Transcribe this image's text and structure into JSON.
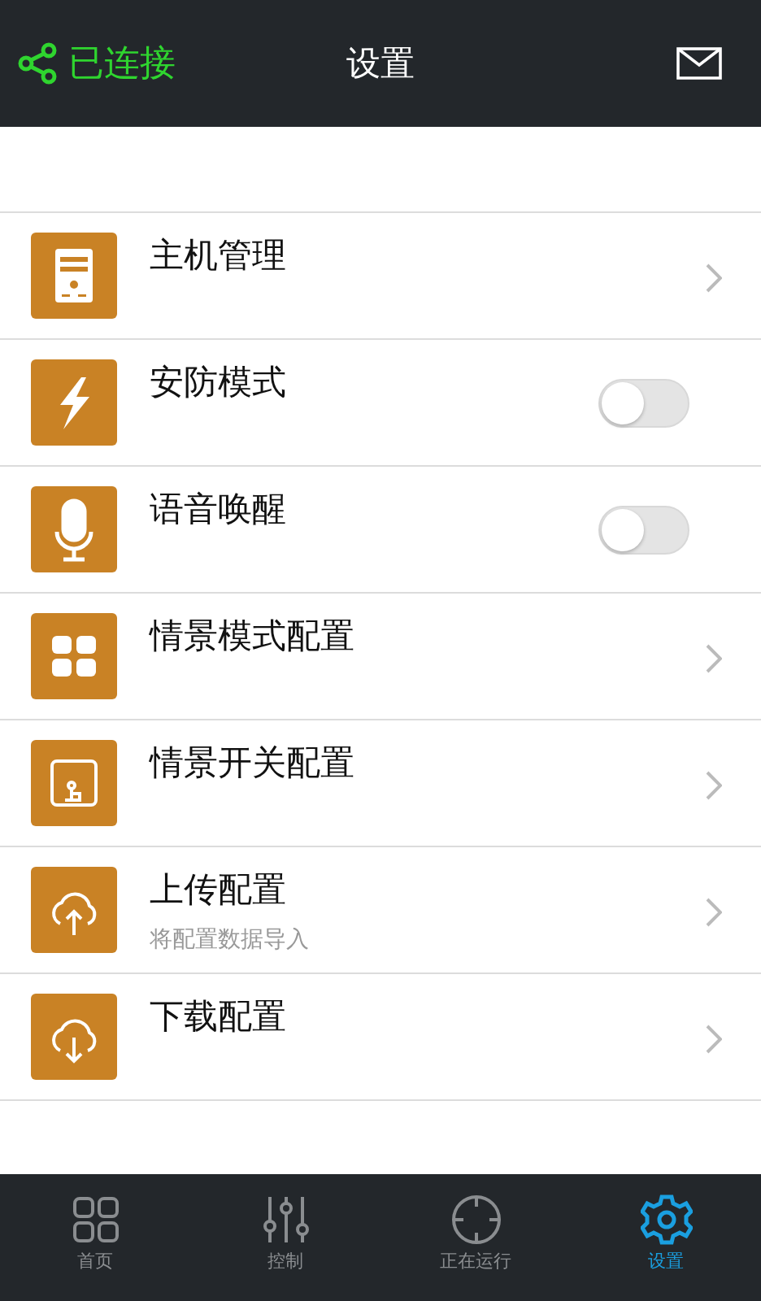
{
  "header": {
    "status": "已连接",
    "title": "设置"
  },
  "settings": [
    {
      "kind": "link",
      "title": "主机管理"
    },
    {
      "kind": "switch",
      "title": "安防模式",
      "on": false
    },
    {
      "kind": "switch",
      "title": "语音唤醒",
      "on": false
    },
    {
      "kind": "link",
      "title": "情景模式配置"
    },
    {
      "kind": "link",
      "title": "情景开关配置"
    },
    {
      "kind": "link",
      "title": "上传配置",
      "subtitle": "将配置数据导入"
    },
    {
      "kind": "link",
      "title": "下载配置"
    }
  ],
  "tabs": [
    {
      "label": "首页",
      "selected": false
    },
    {
      "label": "控制",
      "selected": false
    },
    {
      "label": "正在运行",
      "selected": false
    },
    {
      "label": "设置",
      "selected": true
    }
  ]
}
